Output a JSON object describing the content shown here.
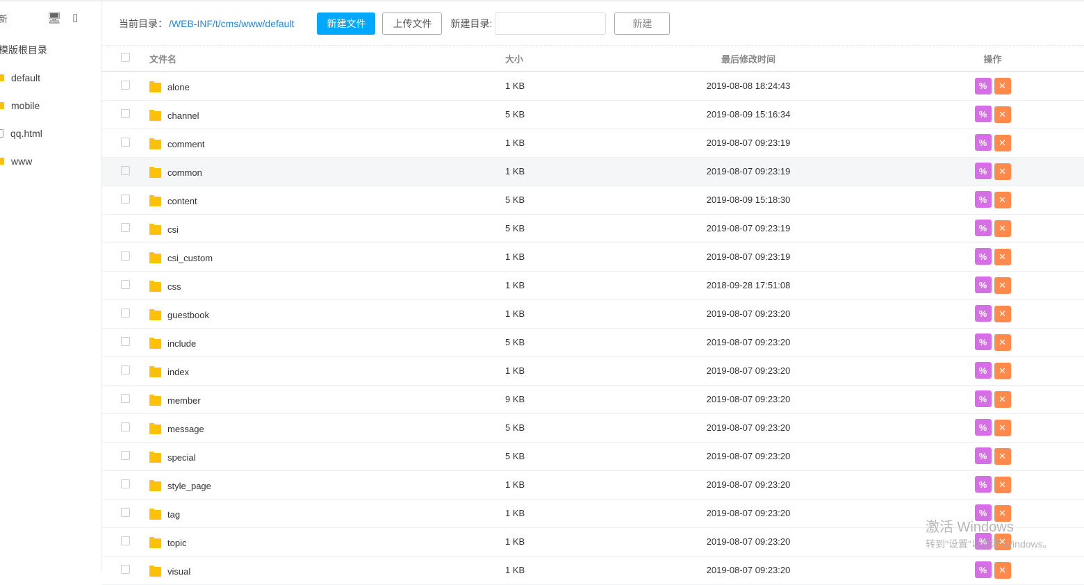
{
  "sidebar": {
    "head": "新",
    "root": "模版根目录",
    "items": [
      {
        "label": "default",
        "type": "folder"
      },
      {
        "label": "mobile",
        "type": "folder"
      },
      {
        "label": "qq.html",
        "type": "file"
      },
      {
        "label": "www",
        "type": "folder"
      }
    ]
  },
  "toolbar": {
    "current_label": "当前目录：",
    "current_path": "/WEB-INF/t/cms/www/default",
    "new_file": "新建文件",
    "upload": "上传文件",
    "new_dir_label": "新建目录:",
    "new_dir_value": "",
    "create": "新建"
  },
  "table": {
    "headers": {
      "name": "文件名",
      "size": "大小",
      "time": "最后修改时间",
      "ops": "操作"
    },
    "rows": [
      {
        "name": "alone",
        "size": "1 KB",
        "time": "2019-08-08 18:24:43"
      },
      {
        "name": "channel",
        "size": "5 KB",
        "time": "2019-08-09 15:16:34"
      },
      {
        "name": "comment",
        "size": "1 KB",
        "time": "2019-08-07 09:23:19"
      },
      {
        "name": "common",
        "size": "1 KB",
        "time": "2019-08-07 09:23:19"
      },
      {
        "name": "content",
        "size": "5 KB",
        "time": "2019-08-09 15:18:30"
      },
      {
        "name": "csi",
        "size": "5 KB",
        "time": "2019-08-07 09:23:19"
      },
      {
        "name": "csi_custom",
        "size": "1 KB",
        "time": "2019-08-07 09:23:19"
      },
      {
        "name": "css",
        "size": "1 KB",
        "time": "2018-09-28 17:51:08"
      },
      {
        "name": "guestbook",
        "size": "1 KB",
        "time": "2019-08-07 09:23:20"
      },
      {
        "name": "include",
        "size": "5 KB",
        "time": "2019-08-07 09:23:20"
      },
      {
        "name": "index",
        "size": "1 KB",
        "time": "2019-08-07 09:23:20"
      },
      {
        "name": "member",
        "size": "9 KB",
        "time": "2019-08-07 09:23:20"
      },
      {
        "name": "message",
        "size": "5 KB",
        "time": "2019-08-07 09:23:20"
      },
      {
        "name": "special",
        "size": "5 KB",
        "time": "2019-08-07 09:23:20"
      },
      {
        "name": "style_page",
        "size": "1 KB",
        "time": "2019-08-07 09:23:20"
      },
      {
        "name": "tag",
        "size": "1 KB",
        "time": "2019-08-07 09:23:20"
      },
      {
        "name": "topic",
        "size": "1 KB",
        "time": "2019-08-07 09:23:20"
      },
      {
        "name": "visual",
        "size": "1 KB",
        "time": "2019-08-07 09:23:20"
      }
    ]
  },
  "watermark": {
    "line1": "激活 Windows",
    "line2": "转到\"设置\"以激活 Windows。"
  },
  "colors": {
    "primary": "#00a8ff",
    "rename": "#d66fe6",
    "delete": "#ff8a4c",
    "folder": "#ffc107"
  }
}
